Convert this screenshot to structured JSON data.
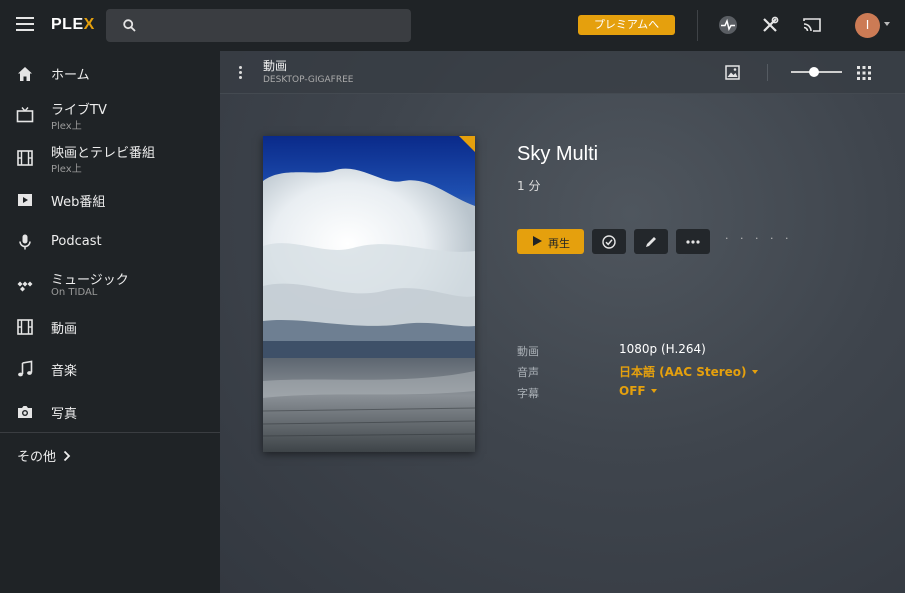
{
  "topbar": {
    "logo_main": "PLE",
    "logo_accent": "X",
    "premium_label": "プレミアムへ",
    "avatar_initial": "I",
    "icons": [
      "hamburger-icon",
      "search-icon",
      "activity-icon",
      "tools-icon",
      "cast-icon",
      "avatar"
    ]
  },
  "sidebar": {
    "items": [
      {
        "label": "ホーム",
        "sub": "",
        "icon": "home-icon"
      },
      {
        "label": "ライブTV",
        "sub": "Plex上",
        "icon": "tv-icon"
      },
      {
        "label": "映画とテレビ番組",
        "sub": "Plex上",
        "icon": "film-icon"
      },
      {
        "label": "Web番組",
        "sub": "",
        "icon": "play-icon"
      },
      {
        "label": "Podcast",
        "sub": "",
        "icon": "microphone-icon"
      },
      {
        "label": "ミュージック",
        "sub": "On TIDAL",
        "icon": "tidal-icon"
      },
      {
        "label": "動画",
        "sub": "",
        "icon": "film-icon"
      },
      {
        "label": "音楽",
        "sub": "",
        "icon": "music-note-icon"
      },
      {
        "label": "写真",
        "sub": "",
        "icon": "camera-icon"
      }
    ],
    "more_label": "その他"
  },
  "header": {
    "title": "動画",
    "subtitle": "DESKTOP-GIGAFREE",
    "zoom_level": 0.45
  },
  "media": {
    "title": "Sky Multi",
    "duration": "1 分",
    "play_label": "再生",
    "loading": "· · · · ·",
    "details": [
      {
        "key": "動画",
        "value": "1080p (H.264)",
        "dropdown": false
      },
      {
        "key": "音声",
        "value": "日本語 (AAC Stereo)",
        "dropdown": true
      },
      {
        "key": "字幕",
        "value": "OFF",
        "dropdown": true
      }
    ]
  },
  "colors": {
    "accent": "#e5a00d",
    "sidebar_bg": "#1f2326",
    "main_bg": "#3f454d"
  }
}
